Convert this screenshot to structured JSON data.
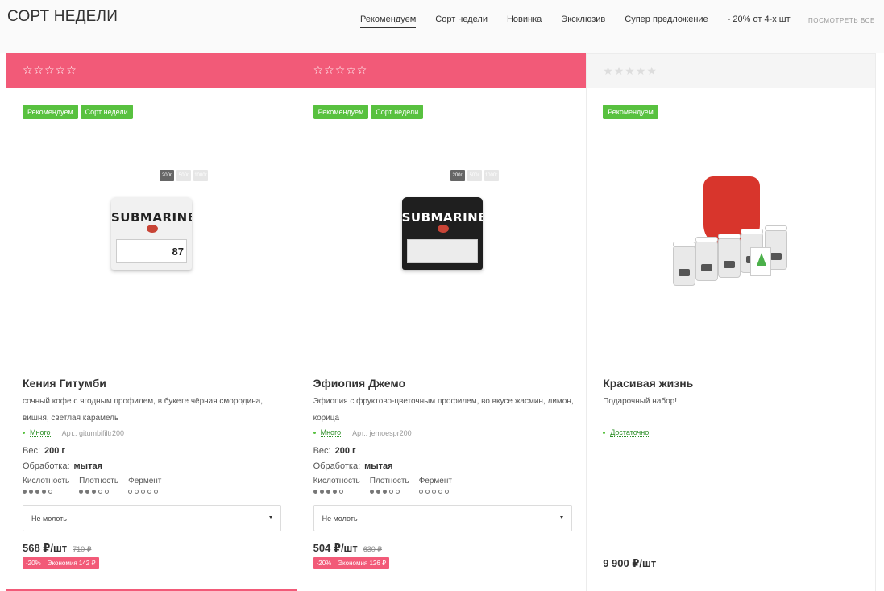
{
  "header": {
    "title": "СОРТ НЕДЕЛИ",
    "tabs": [
      {
        "label": "Рекомендуем",
        "active": true
      },
      {
        "label": "Сорт недели",
        "active": false
      },
      {
        "label": "Новинка",
        "active": false
      },
      {
        "label": "Эксклюзив",
        "active": false
      },
      {
        "label": "Супер предложение",
        "active": false
      },
      {
        "label": "- 20% от 4-х шт",
        "active": false
      }
    ],
    "view_all": "посмотреть все"
  },
  "colors": {
    "accent": "#f25a78",
    "badge_green": "#58c13f",
    "stock_green": "#2c8f27"
  },
  "products": [
    {
      "stars": "☆☆☆☆☆",
      "badges": [
        "Рекомендуем",
        "Сорт недели"
      ],
      "weight_options": [
        "200г",
        "500г",
        "1000г"
      ],
      "pack_brand": "SUBMARINE",
      "pack_number": "87",
      "name": "Кения Гитумби",
      "description": "сочный кофе с ягодным профилем, в букете чёрная смородина, вишня, светлая карамель",
      "stock": "Много",
      "article": "Арт.: gitumbifiltr200",
      "weight_label": "Вес:",
      "weight_value": "200 г",
      "processing_label": "Обработка:",
      "processing_value": "мытая",
      "scales": [
        {
          "label": "Кислотность",
          "level": 4,
          "max": 5
        },
        {
          "label": "Плотность",
          "level": 3,
          "max": 5
        },
        {
          "label": "Фермент",
          "level": 0,
          "max": 5
        }
      ],
      "grind": "Не молоть",
      "price": "568 ₽/шт",
      "old_price": "710 ₽",
      "discount_percent": "-20%",
      "economy": "Экономия 142 ₽"
    },
    {
      "stars": "☆☆☆☆☆",
      "badges": [
        "Рекомендуем",
        "Сорт недели"
      ],
      "weight_options": [
        "200г",
        "500г",
        "1000г"
      ],
      "pack_brand": "SUBMARINE",
      "name": "Эфиопия Джемо",
      "description": "Эфиопия с фруктово-цветочным профилем, во вкусе жасмин, лимон, корица",
      "stock": "Много",
      "article": "Арт.: jemoespr200",
      "weight_label": "Вес:",
      "weight_value": "200 г",
      "processing_label": "Обработка:",
      "processing_value": "мытая",
      "scales": [
        {
          "label": "Кислотность",
          "level": 4,
          "max": 5
        },
        {
          "label": "Плотность",
          "level": 3,
          "max": 5
        },
        {
          "label": "Фермент",
          "level": 0,
          "max": 5
        }
      ],
      "grind": "Не молоть",
      "price": "504 ₽/шт",
      "old_price": "630 ₽",
      "discount_percent": "-20%",
      "economy": "Экономия 126 ₽"
    },
    {
      "stars": "★★★★★",
      "badges": [
        "Рекомендуем"
      ],
      "name": "Красивая жизнь",
      "description": "Подарочный набор!",
      "stock": "Достаточно",
      "price": "9 900 ₽/шт"
    }
  ]
}
